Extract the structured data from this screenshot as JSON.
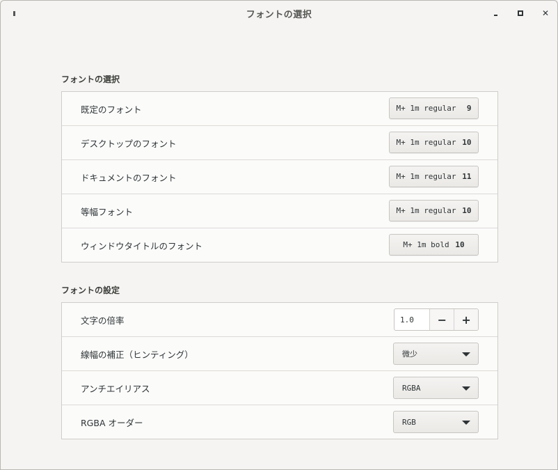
{
  "window": {
    "title": "フォントの選択"
  },
  "font_selection": {
    "title": "フォントの選択",
    "rows": [
      {
        "label": "既定のフォント",
        "font": "M+ 1m regular",
        "size": "9"
      },
      {
        "label": "デスクトップのフォント",
        "font": "M+ 1m regular",
        "size": "10"
      },
      {
        "label": "ドキュメントのフォント",
        "font": "M+ 1m regular",
        "size": "11"
      },
      {
        "label": "等幅フォント",
        "font": "M+ 1m regular",
        "size": "10"
      },
      {
        "label": "ウィンドウタイトルのフォント",
        "font": "M+ 1m bold",
        "size": "10"
      }
    ]
  },
  "font_settings": {
    "title": "フォントの設定",
    "scaling": {
      "label": "文字の倍率",
      "value": "1.0",
      "minus": "−",
      "plus": "+"
    },
    "hinting": {
      "label": "線幅の補正（ヒンティング）",
      "value": "微少"
    },
    "antialiasing": {
      "label": "アンチエイリアス",
      "value": "RGBA"
    },
    "rgba_order": {
      "label": "RGBA オーダー",
      "value": "RGB"
    }
  },
  "icons": {
    "menu": "menu-icon",
    "minimize": "minimize-icon",
    "maximize": "maximize-icon",
    "close": "close-icon",
    "dropdown": "chevron-down-icon"
  }
}
